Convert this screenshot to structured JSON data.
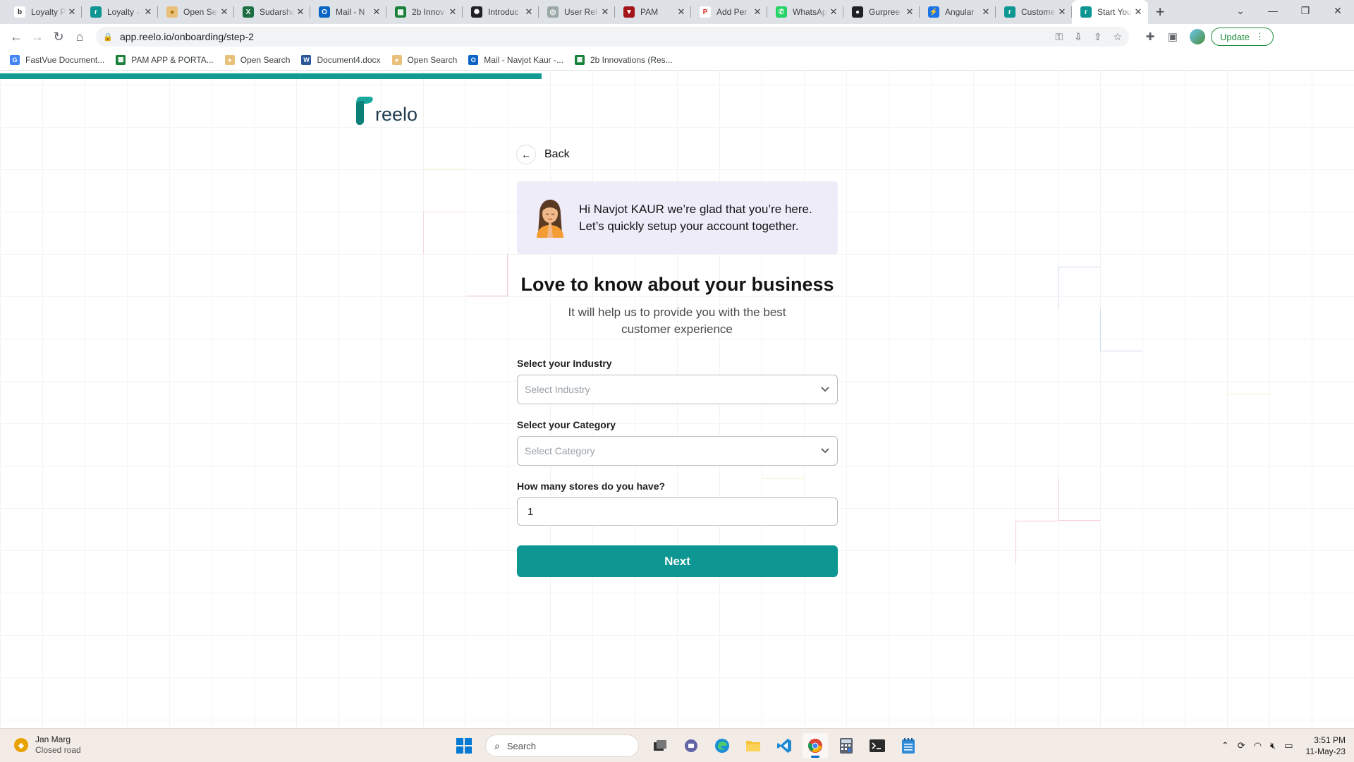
{
  "browser": {
    "tabs": [
      {
        "title": "Loyalty P",
        "fav": "b",
        "fav_color": "#ffffff",
        "fav_fg": "#202020",
        "active": false
      },
      {
        "title": "Loyalty -",
        "fav": "r",
        "fav_color": "#0e9692",
        "fav_fg": "#ffffff",
        "active": false
      },
      {
        "title": "Open Se",
        "fav": "●",
        "fav_color": "#e8c07a",
        "fav_fg": "#a86f00",
        "active": false
      },
      {
        "title": "Sudarsha",
        "fav": "X",
        "fav_color": "#1d6f42",
        "fav_fg": "#ffffff",
        "active": false
      },
      {
        "title": "Mail - N",
        "fav": "O",
        "fav_color": "#0a64c4",
        "fav_fg": "#ffffff",
        "active": false
      },
      {
        "title": "2b Innov",
        "fav": "▦",
        "fav_color": "#188038",
        "fav_fg": "#ffffff",
        "active": false
      },
      {
        "title": "Introduc",
        "fav": "✺",
        "fav_color": "#202124",
        "fav_fg": "#ffffff",
        "active": false
      },
      {
        "title": "User Rel",
        "fav": "◎",
        "fav_color": "#9aa9a5",
        "fav_fg": "#ffffff",
        "active": false
      },
      {
        "title": "PAM",
        "fav": "▼",
        "fav_color": "#a4161a",
        "fav_fg": "#ffffff",
        "active": false
      },
      {
        "title": "Add Per",
        "fav": "P",
        "fav_color": "#ffffff",
        "fav_fg": "#d93025",
        "active": false
      },
      {
        "title": "WhatsAp",
        "fav": "✆",
        "fav_color": "#25d366",
        "fav_fg": "#ffffff",
        "active": false
      },
      {
        "title": "Gurpree",
        "fav": "●",
        "fav_color": "#202124",
        "fav_fg": "#ffffff",
        "active": false
      },
      {
        "title": "Angular",
        "fav": "⚡",
        "fav_color": "#1a73e8",
        "fav_fg": "#ffffff",
        "active": false
      },
      {
        "title": "Custome",
        "fav": "r",
        "fav_color": "#0e9692",
        "fav_fg": "#ffffff",
        "active": false
      },
      {
        "title": "Start You",
        "fav": "r",
        "fav_color": "#0e9692",
        "fav_fg": "#ffffff",
        "active": true
      }
    ],
    "url": "app.reelo.io/onboarding/step-2",
    "update_label": "Update",
    "bookmarks": [
      {
        "label": "FastVue Document...",
        "icon": "G",
        "color": "#4285f4"
      },
      {
        "label": "PAM APP & PORTA...",
        "icon": "▦",
        "color": "#188038"
      },
      {
        "label": "Open Search",
        "icon": "●",
        "color": "#e8c07a"
      },
      {
        "label": "Document4.docx",
        "icon": "W",
        "color": "#2b579a"
      },
      {
        "label": "Open Search",
        "icon": "●",
        "color": "#e8c07a"
      },
      {
        "label": "Mail - Navjot Kaur -...",
        "icon": "O",
        "color": "#0a64c4"
      },
      {
        "label": "2b Innovations (Res...",
        "icon": "▦",
        "color": "#188038"
      }
    ]
  },
  "page": {
    "progress_percent": 40,
    "brand": {
      "name": "reelo",
      "accent": "#0e9692"
    },
    "back_label": "Back",
    "welcome": "Hi Navjot KAUR we’re glad that you’re here. Let’s quickly setup your account together.",
    "heading": "Love to know about your business",
    "subheading": "It will help us to provide you with the best customer experience",
    "industry": {
      "label": "Select your Industry",
      "placeholder": "Select Industry"
    },
    "category": {
      "label": "Select your Category",
      "placeholder": "Select Category"
    },
    "stores": {
      "label": "How many stores do you have?",
      "value": "1"
    },
    "next_label": "Next"
  },
  "taskbar": {
    "weather_title": "Jan Marg",
    "weather_sub": "Closed road",
    "search_placeholder": "Search",
    "time": "3:51 PM",
    "date": "11-May-23"
  }
}
